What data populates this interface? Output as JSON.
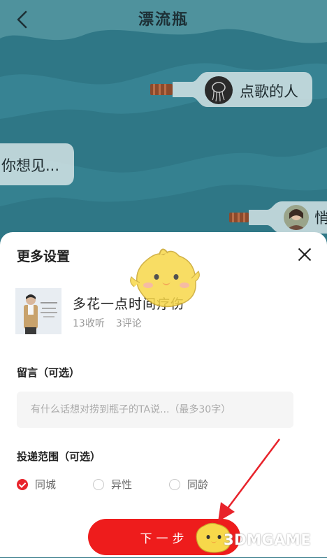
{
  "header": {
    "title": "漂流瓶",
    "back_icon": "back-arrow-icon"
  },
  "bottles": [
    {
      "label": "点歌的人"
    },
    {
      "label": "你想见..."
    },
    {
      "label": "悄"
    }
  ],
  "sheet": {
    "title": "更多设置",
    "close_icon": "close-icon",
    "song": {
      "title": "多花一点时间疗伤",
      "favorites": "13收听",
      "comments": "3评论"
    },
    "message": {
      "label": "留言（可选）",
      "placeholder": "有什么话想对捞到瓶子的TA说...（最多30字）",
      "value": ""
    },
    "scope": {
      "label": "投递范围（可选）",
      "options": [
        {
          "label": "同城",
          "selected": true
        },
        {
          "label": "异性",
          "selected": false
        },
        {
          "label": "同龄",
          "selected": false
        }
      ]
    },
    "next_button": "下一步"
  },
  "watermark": "3DMGAME",
  "colors": {
    "ocean": "#2f7786",
    "ocean_light": "#3d8e9c",
    "accent": "#ee1c1c",
    "sheet_bg": "#ffffff"
  }
}
